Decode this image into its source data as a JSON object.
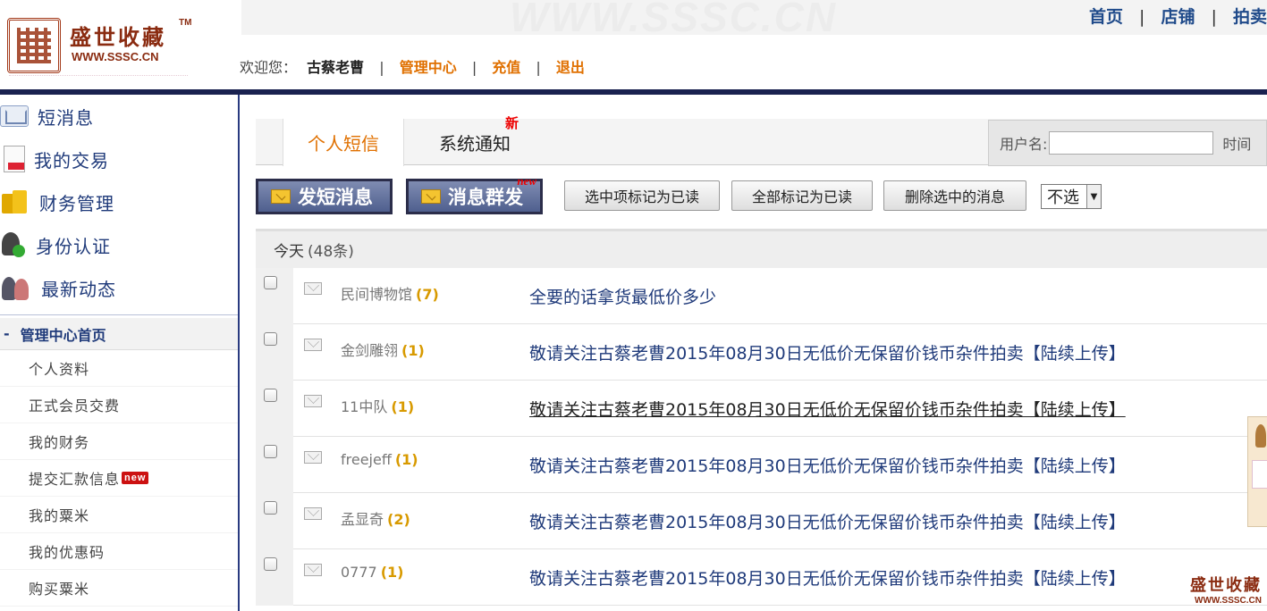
{
  "site": {
    "brand": "盛世收藏",
    "trademark": "TM",
    "domain": "WWW.SSSC.CN",
    "watermark": "WWW.SSSC.CN"
  },
  "header": {
    "welcome_prefix": "欢迎您：",
    "username": "古蔡老曹",
    "links": [
      "管理中心",
      "充值",
      "退出"
    ],
    "separator": "|"
  },
  "top_nav": [
    "首页",
    "店铺",
    "拍卖"
  ],
  "sidebar": {
    "main_items": [
      {
        "label": "短消息",
        "icon": "message-icon"
      },
      {
        "label": "我的交易",
        "icon": "document-icon"
      },
      {
        "label": "财务管理",
        "icon": "money-icon"
      },
      {
        "label": "身份认证",
        "icon": "id-verify-icon"
      },
      {
        "label": "最新动态",
        "icon": "people-icon"
      }
    ],
    "section_toggle": "-",
    "section_title": "管理中心首页",
    "sub_items": [
      "个人资料",
      "正式会员交费",
      "我的财务",
      "提交汇款信息",
      "我的粟米",
      "我的优惠码",
      "购买粟米"
    ],
    "new_badge": "new"
  },
  "tabs": [
    {
      "label": "个人短信",
      "active": true
    },
    {
      "label": "系统通知",
      "active": false,
      "mark": "新"
    }
  ],
  "search": {
    "username_label": "用户名:",
    "username_value": "",
    "time_label": "时间"
  },
  "toolbar": {
    "send_label": "发短消息",
    "group_label": "消息群发",
    "group_new_tag": "new",
    "mark_selected_read": "选中项标记为已读",
    "mark_all_read": "全部标记为已读",
    "delete_selected": "删除选中的消息",
    "select_value": "不选"
  },
  "list": {
    "day_label": "今天",
    "day_count": "(48条)",
    "messages": [
      {
        "sender": "民间博物馆",
        "count": "(7)",
        "subject": "全要的话拿货最低价多少"
      },
      {
        "sender": "金剑雕翎",
        "count": "(1)",
        "subject": "敬请关注古蔡老曹2015年08月30日无低价无保留价钱币杂件拍卖【陆续上传】"
      },
      {
        "sender": "11中队",
        "count": "(1)",
        "subject": "敬请关注古蔡老曹2015年08月30日无低价无保留价钱币杂件拍卖【陆续上传】"
      },
      {
        "sender": "freejeff",
        "count": "(1)",
        "subject": "敬请关注古蔡老曹2015年08月30日无低价无保留价钱币杂件拍卖【陆续上传】"
      },
      {
        "sender": "孟显奇",
        "count": "(2)",
        "subject": "敬请关注古蔡老曹2015年08月30日无低价无保留价钱币杂件拍卖【陆续上传】"
      },
      {
        "sender": "0777",
        "count": "(1)",
        "subject": "敬请关注古蔡老曹2015年08月30日无低价无保留价钱币杂件拍卖【陆续上传】"
      }
    ]
  },
  "colors": {
    "nav_blue": "#1f3a7a",
    "accent_orange": "#e07000",
    "header_rule": "#1a2250",
    "brand_red": "#8a2b10"
  }
}
